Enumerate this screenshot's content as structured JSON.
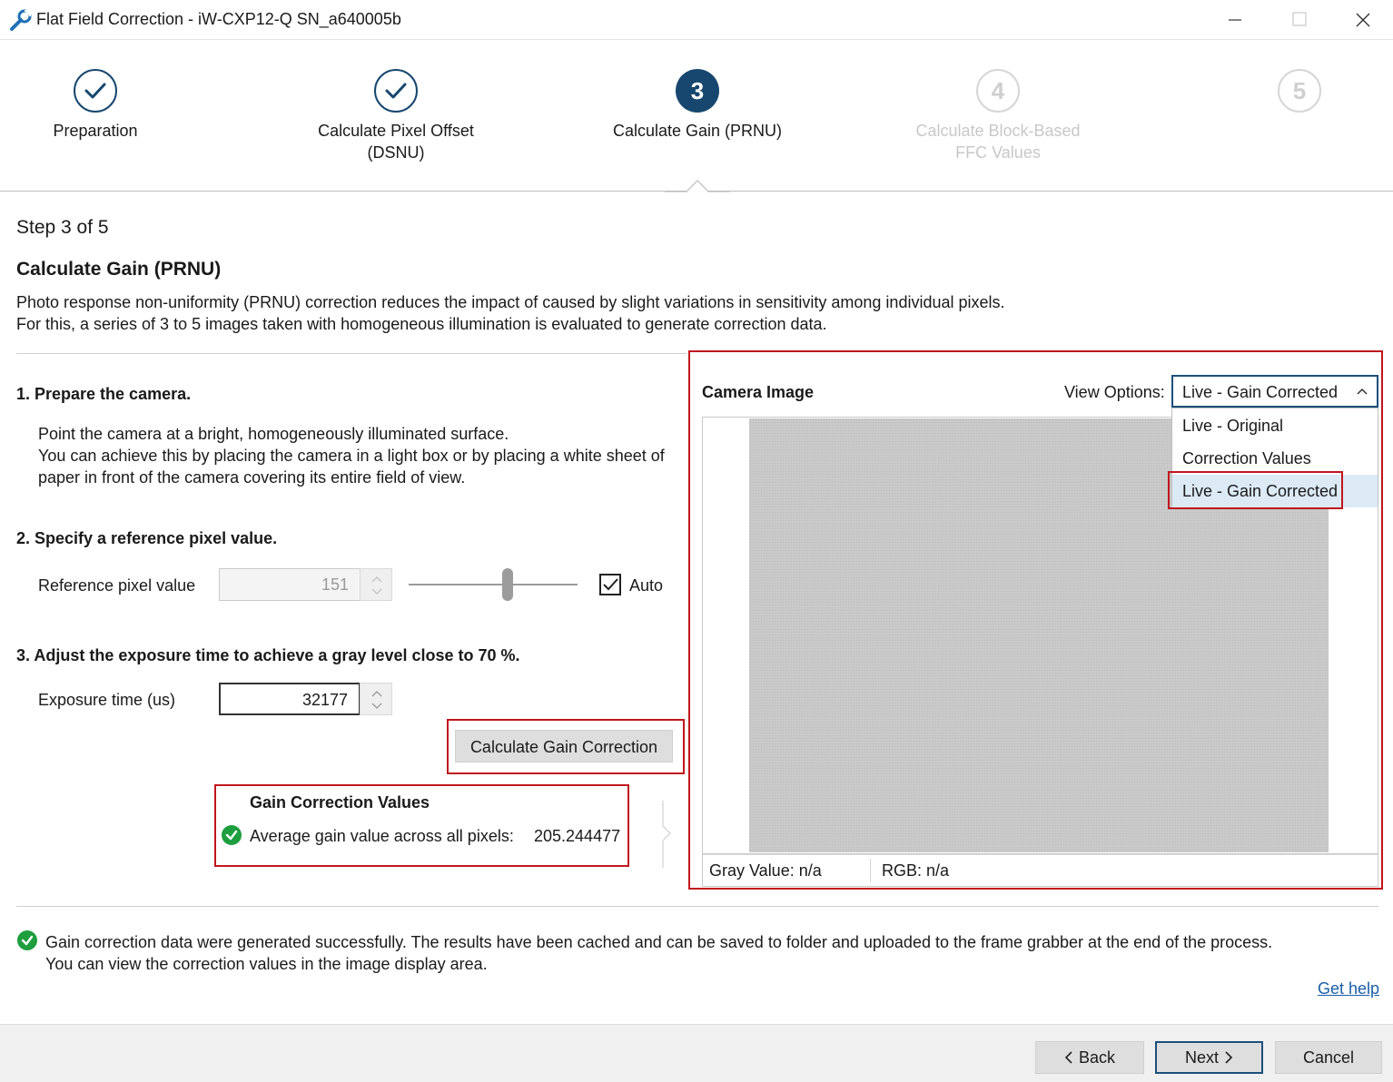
{
  "window": {
    "title": "Flat Field Correction - iW-CXP12-Q SN_a640005b",
    "minimize_label": "Minimize",
    "maximize_label": "Maximize",
    "close_label": "Close"
  },
  "steps": [
    {
      "number": "1",
      "label": "Preparation",
      "state": "done"
    },
    {
      "number": "2",
      "label": "Calculate Pixel Offset (DSNU)",
      "state": "done"
    },
    {
      "number": "3",
      "label": "Calculate Gain (PRNU)",
      "state": "active"
    },
    {
      "number": "4",
      "label": "Calculate Block-Based FFC Values",
      "state": "future"
    },
    {
      "number": "5",
      "label": "",
      "state": "future"
    }
  ],
  "page": {
    "step_counter": "Step 3 of 5",
    "title": "Calculate Gain (PRNU)",
    "description_line1": "Photo response non-uniformity (PRNU) correction reduces the impact of caused by slight variations in sensitivity among individual pixels.",
    "description_line2": "For this, a series of 3 to 5 images taken with homogeneous illumination is evaluated to generate correction data."
  },
  "section1": {
    "heading": "1. Prepare the camera.",
    "line1": "Point the camera at a bright, homogeneously illuminated surface.",
    "line2": "You can achieve this by placing the camera in a light box or by placing a white sheet of",
    "line3": "paper in front of the camera covering its entire field of view."
  },
  "section2": {
    "heading": "2. Specify a reference pixel value.",
    "ref_label": "Reference pixel value",
    "ref_value": "151",
    "slider_fraction": 0.59,
    "auto_label": "Auto",
    "auto_checked": true
  },
  "section3": {
    "heading": "3. Adjust the exposure time to achieve a gray level close to 70 %.",
    "exposure_label": "Exposure time (us)",
    "exposure_value": "32177",
    "calculate_button": "Calculate Gain Correction"
  },
  "gain_values": {
    "heading": "Gain Correction Values",
    "avg_label": "Average gain value across all pixels:",
    "avg_value": "205.244477"
  },
  "camera": {
    "title": "Camera Image",
    "view_options_label": "View Options:",
    "view_selected": "Live - Gain Corrected",
    "view_options": [
      "Live - Original",
      "Correction Values",
      "Live - Gain Corrected"
    ],
    "gray_value": "Gray Value: n/a",
    "rgb_value": "RGB: n/a"
  },
  "status": {
    "line1": "Gain correction data were generated successfully. The results have been cached and can be saved to folder and uploaded to the frame grabber at the end of the process.",
    "line2": "You can view the correction values in the image display area.",
    "help_link": "Get help"
  },
  "footer": {
    "back": "Back",
    "next": "Next",
    "cancel": "Cancel"
  },
  "colors": {
    "accent": "#17476e",
    "highlight_red": "#c0161e",
    "success_green": "#1e9e3e",
    "link": "#1a5fa8"
  }
}
